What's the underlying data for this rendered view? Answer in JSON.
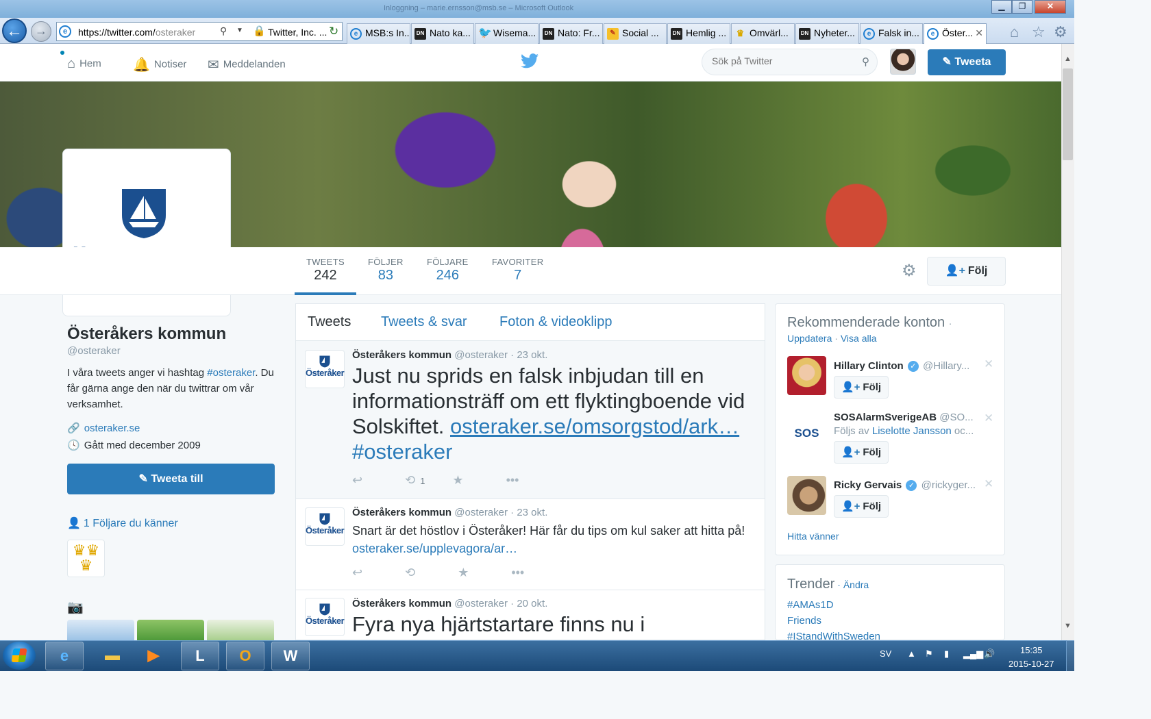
{
  "browser": {
    "window_title": "Inloggning – marie.ernsson@msb.se – Microsoft Outlook",
    "address": {
      "host": "https://twitter.com/",
      "path": "osteraker",
      "cert": "Twitter, Inc. ..."
    },
    "tabs": [
      {
        "label": "MSB:s In...",
        "icon": "ie-icon"
      },
      {
        "label": "Nato ka...",
        "icon": "dn-icon"
      },
      {
        "label": "Wisema...",
        "icon": "twitter-icon"
      },
      {
        "label": "Nato: Fr...",
        "icon": "dn-icon"
      },
      {
        "label": "Social ...",
        "icon": "pen-icon"
      },
      {
        "label": "Hemlig ...",
        "icon": "dn-icon"
      },
      {
        "label": "Omvärl...",
        "icon": "crown-icon"
      },
      {
        "label": "Nyheter...",
        "icon": "dn-icon"
      },
      {
        "label": "Falsk in...",
        "icon": "ie-icon"
      },
      {
        "label": "Öster...",
        "icon": "ie-icon",
        "active": true
      }
    ]
  },
  "twitter_nav": {
    "home": "Hem",
    "notifications": "Notiser",
    "messages": "Meddelanden",
    "search_placeholder": "Sök på Twitter",
    "tweet_button": "Tweeta"
  },
  "profile": {
    "logo_text": "Österåker",
    "name": "Österåkers kommun",
    "handle": "@osteraker",
    "bio_before": "I våra tweets anger vi hashtag ",
    "bio_hashtag": "#osteraker",
    "bio_after": ". Du får gärna ange den när du twittrar om vår verksamhet.",
    "url": "osteraker.se",
    "joined": "Gått med december 2009",
    "tweet_to": "Tweeta till",
    "followers_you_know": "1 Följare du känner"
  },
  "stats": [
    {
      "label": "TWEETS",
      "value": "242"
    },
    {
      "label": "FÖLJER",
      "value": "83"
    },
    {
      "label": "FÖLJARE",
      "value": "246"
    },
    {
      "label": "FAVORITER",
      "value": "7"
    }
  ],
  "follow_button": "Följ",
  "timeline": {
    "tabs": [
      "Tweets",
      "Tweets & svar",
      "Foton & videoklipp"
    ],
    "tweets": [
      {
        "name": "Österåkers kommun",
        "meta": "@osteraker · 23 okt.",
        "text": "Just nu sprids en falsk inbjudan till en informationsträff om ett flyktingboende vid Solskiftet. ",
        "link": "osteraker.se/omsorgstod/ark…",
        "hashtag": "#osteraker",
        "retweets": "1"
      },
      {
        "name": "Österåkers kommun",
        "meta": "@osteraker · 23 okt.",
        "text": "Snart är det höstlov i Österåker! Här får du tips om kul saker att hitta på! ",
        "link": "osteraker.se/upplevagora/ar…"
      },
      {
        "name": "Österåkers kommun",
        "meta": "@osteraker · 20 okt.",
        "text": "Fyra nya hjärtstartare finns nu i"
      }
    ]
  },
  "recommended": {
    "title": "Rekommenderade konton",
    "dot": "·",
    "update": "Uppdatera",
    "view_all": "Visa alla",
    "separator": "·",
    "accounts": [
      {
        "name": "Hillary Clinton",
        "handle": "@Hillary...",
        "verified": true,
        "follow": "Följ"
      },
      {
        "name": "SOSAlarmSverigeAB",
        "handle": "@SO...",
        "verified": false,
        "sub_before": "Följs av ",
        "sub_link": "Liselotte Jansson",
        "sub_after": " oc...",
        "avatar_text": "SOS",
        "follow": "Följ"
      },
      {
        "name": "Ricky Gervais",
        "handle": "@rickyger...",
        "verified": true,
        "follow": "Följ"
      }
    ],
    "find_friends": "Hitta vänner"
  },
  "trends": {
    "title": "Trender",
    "change": "· Ändra",
    "items": [
      "#AMAs1D",
      "Friends",
      "#IStandWithSweden"
    ]
  },
  "taskbar": {
    "language": "SV",
    "time": "15:35",
    "date": "2015-10-27"
  },
  "colors": {
    "twitter_blue": "#2b7bb9",
    "link_blue": "#2b7bb9",
    "osteraker_blue": "#1b4f8f"
  }
}
